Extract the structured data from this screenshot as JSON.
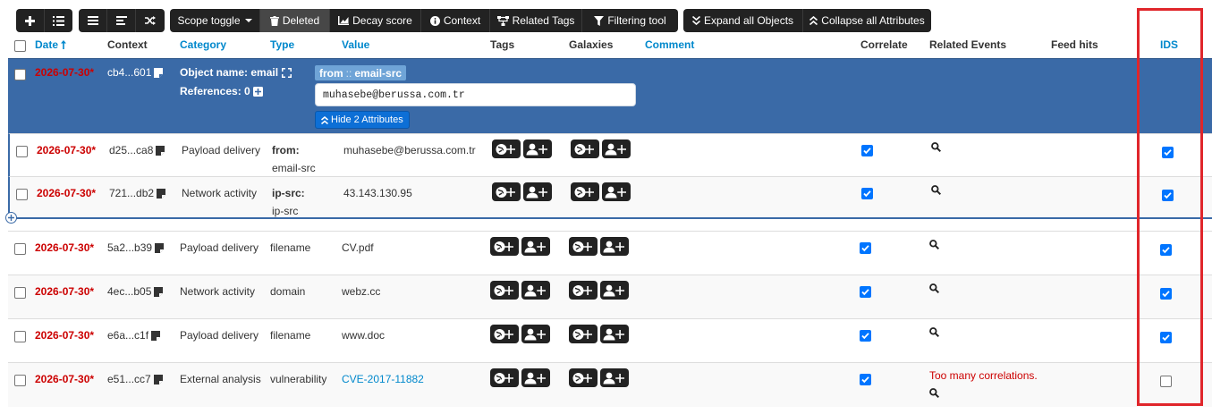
{
  "toolbar": {
    "scope_toggle": "Scope toggle",
    "deleted": "Deleted",
    "decay_score": "Decay score",
    "context": "Context",
    "related_tags": "Related Tags",
    "filtering_tool": "Filtering tool",
    "expand_all": "Expand all Objects",
    "collapse_all": "Collapse all Attributes"
  },
  "columns": {
    "date": "Date",
    "context": "Context",
    "category": "Category",
    "type": "Type",
    "value": "Value",
    "tags": "Tags",
    "galaxies": "Galaxies",
    "comment": "Comment",
    "correlate": "Correlate",
    "related_events": "Related Events",
    "feed_hits": "Feed hits",
    "ids": "IDS"
  },
  "object": {
    "date": "2026-07-30*",
    "context": "cb4...601",
    "name_label": "Object name: email",
    "references_label": "References: 0",
    "relation_from": "from",
    "relation_sep": "::",
    "relation_type": "email-src",
    "value": "muhasebe@berussa.com.tr",
    "hide_button": "Hide 2 Attributes"
  },
  "rows": [
    {
      "date": "2026-07-30*",
      "context": "d25...ca8",
      "category": "Payload delivery",
      "type": "from:",
      "type2": "email-src",
      "value": "muhasebe@berussa.com.tr",
      "correlate": true,
      "ids": true,
      "related": ""
    },
    {
      "date": "2026-07-30*",
      "context": "721...db2",
      "category": "Network activity",
      "type": "ip-src:",
      "type2": "ip-src",
      "value": "43.143.130.95",
      "correlate": true,
      "ids": true,
      "related": ""
    },
    {
      "date": "2026-07-30*",
      "context": "5a2...b39",
      "category": "Payload delivery",
      "type": "filename",
      "type2": "",
      "value": "CV.pdf",
      "correlate": true,
      "ids": true,
      "related": ""
    },
    {
      "date": "2026-07-30*",
      "context": "4ec...b05",
      "category": "Network activity",
      "type": "domain",
      "type2": "",
      "value": "webz.cc",
      "correlate": true,
      "ids": true,
      "related": ""
    },
    {
      "date": "2026-07-30*",
      "context": "e6a...c1f",
      "category": "Payload delivery",
      "type": "filename",
      "type2": "",
      "value": "www.doc",
      "correlate": true,
      "ids": true,
      "related": ""
    },
    {
      "date": "2026-07-30*",
      "context": "e51...cc7",
      "category": "External analysis",
      "type": "vulnerability",
      "type2": "",
      "value": "CVE-2017-11882",
      "correlate": true,
      "ids": false,
      "related": "Too many correlations."
    }
  ],
  "colors": {
    "accent_link": "#0088cc",
    "object_row_bg": "#3a6aa7",
    "date_red": "#cc0000",
    "highlight_box": "#e0262b",
    "toolbar_bg": "#222222"
  }
}
